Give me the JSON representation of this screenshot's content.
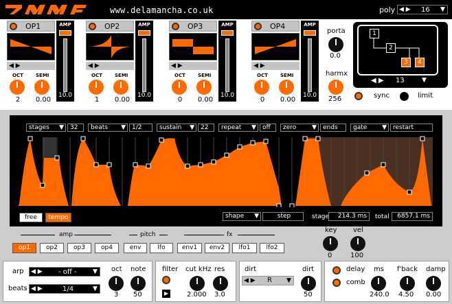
{
  "header": {
    "url": "www.delamancha.co.uk",
    "poly_label": "poly",
    "poly_value": "16"
  },
  "operators": [
    {
      "name": "OP1",
      "oct": "2",
      "semi": "0.00",
      "amp": "10.0"
    },
    {
      "name": "OP2",
      "oct": "1",
      "semi": "0.00",
      "amp": "10.0"
    },
    {
      "name": "OP3",
      "oct": "0",
      "semi": "0.00",
      "amp": "10.0"
    },
    {
      "name": "OP4",
      "oct": "0",
      "semi": "0.00",
      "amp": "10.0"
    }
  ],
  "op_labels": {
    "oct": "OCT",
    "semi": "SEMI",
    "amp": "AMP"
  },
  "porta": {
    "label": "porta",
    "value": "0.0"
  },
  "harmx": {
    "label": "harmx",
    "value": "256"
  },
  "algorithm": {
    "value": "13",
    "boxes": [
      "1",
      "2",
      "3",
      "4"
    ]
  },
  "sync": {
    "sync_label": "sync",
    "limit_label": "limit"
  },
  "envelope": {
    "stages_label": "stages",
    "stages_value": "32",
    "beats_label": "beats",
    "beats_value": "1/2",
    "sustain_label": "sustain",
    "sustain_value": "22",
    "repeat_label": "repeat",
    "repeat_value": "off",
    "zero_label": "zero",
    "zero_value": "ends",
    "gate_label": "gate",
    "gate_value": "restart",
    "free_label": "free",
    "tempo_label": "tempo",
    "shape_label": "shape",
    "shape_value": "step",
    "stage_label": "stage",
    "stage_value": "214.3 ms",
    "total_label": "total",
    "total_value": "6857.1 ms"
  },
  "targets": {
    "amp_label": "amp",
    "pitch_label": "pitch",
    "fx_label": "fx",
    "buttons": [
      "op1",
      "op2",
      "op3",
      "op4",
      "env",
      "lfo",
      "env1",
      "env2",
      "lfo1",
      "lfo2"
    ]
  },
  "keyvel": {
    "key_label": "key",
    "key_value": "0",
    "vel_label": "vel",
    "vel_value": "100"
  },
  "arp": {
    "arp_label": "arp",
    "arp_value": "- off -",
    "beats_label": "beats",
    "beats_value": "1/4",
    "oct_label": "oct",
    "oct_value": "3",
    "note_label": "note",
    "note_value": "50"
  },
  "filter": {
    "label": "filter",
    "cut_label": "cut kHz",
    "cut_value": "2.000",
    "res_label": "res",
    "res_value": "3.0"
  },
  "dirt": {
    "label": "dirt",
    "sel_value": "R",
    "knob_label": "dirt",
    "knob_value": "50"
  },
  "delay": {
    "delay_label": "delay",
    "comb_label": "comb",
    "ms_label": "ms",
    "ms_value": "240.0",
    "fback_label": "f'back",
    "fback_value": "4.50",
    "damp_label": "damp",
    "damp_value": "0.00"
  }
}
